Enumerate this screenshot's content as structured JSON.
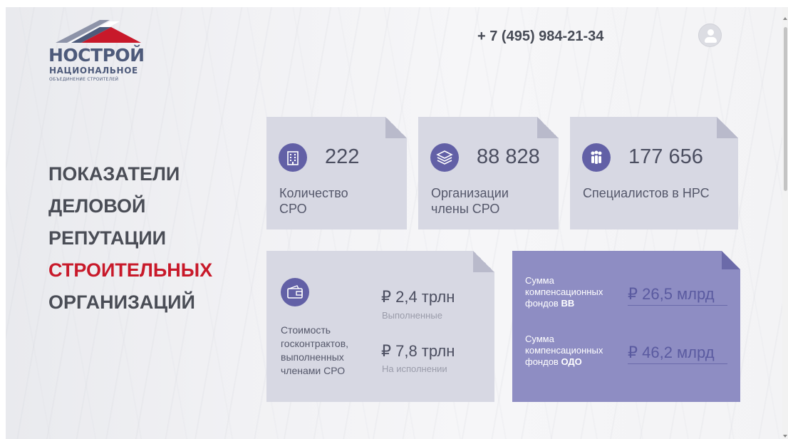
{
  "logo": {
    "main": "НОСТРОЙ",
    "sub": "НАЦИОНАЛЬНОЕ",
    "sub2": "ОБЪЕДИНЕНИЕ СТРОИТЕЛЕЙ",
    "colors": {
      "blue": "#4d5a7a",
      "red": "#c8192a",
      "grey": "#8d93a8"
    }
  },
  "header": {
    "phone": "+ 7 (495) 984-21-34",
    "user_icon": "user-icon"
  },
  "headline": {
    "line1": "ПОКАЗАТЕЛИ",
    "line2": "ДЕЛОВОЙ",
    "line3": "РЕПУТАЦИИ",
    "line4": "СТРОИТЕЛЬНЫХ",
    "line5": "ОРГАНИЗАЦИЙ"
  },
  "stats": [
    {
      "icon": "building-icon",
      "value": "222",
      "label": "Количество СРО"
    },
    {
      "icon": "layers-icon",
      "value": "88 828",
      "label": "Организации члены СРО"
    },
    {
      "icon": "people-icon",
      "value": "177 656",
      "label": "Специалистов в НРС"
    }
  ],
  "contracts": {
    "icon": "wallet-icon",
    "label": "Стоимость госконтрактов, выполненных членами СРО",
    "completed_value": "₽ 2,4 трлн",
    "completed_label": "Выполненные",
    "in_progress_value": "₽ 7,8 трлн",
    "in_progress_label": "На исполнении"
  },
  "funds": {
    "vv_label_prefix": "Сумма компенсационных фондов",
    "vv_label_bold": "ВВ",
    "vv_value": "₽ 26,5 млрд",
    "odo_label_prefix": "Сумма компенсационных фондов",
    "odo_label_bold": "ОДО",
    "odo_value": "₽ 46,2 млрд"
  },
  "colors": {
    "accent": "#6260a6",
    "card": "#d7d8e3",
    "purple_card": "#8e8dc3",
    "red": "#c8192a"
  }
}
